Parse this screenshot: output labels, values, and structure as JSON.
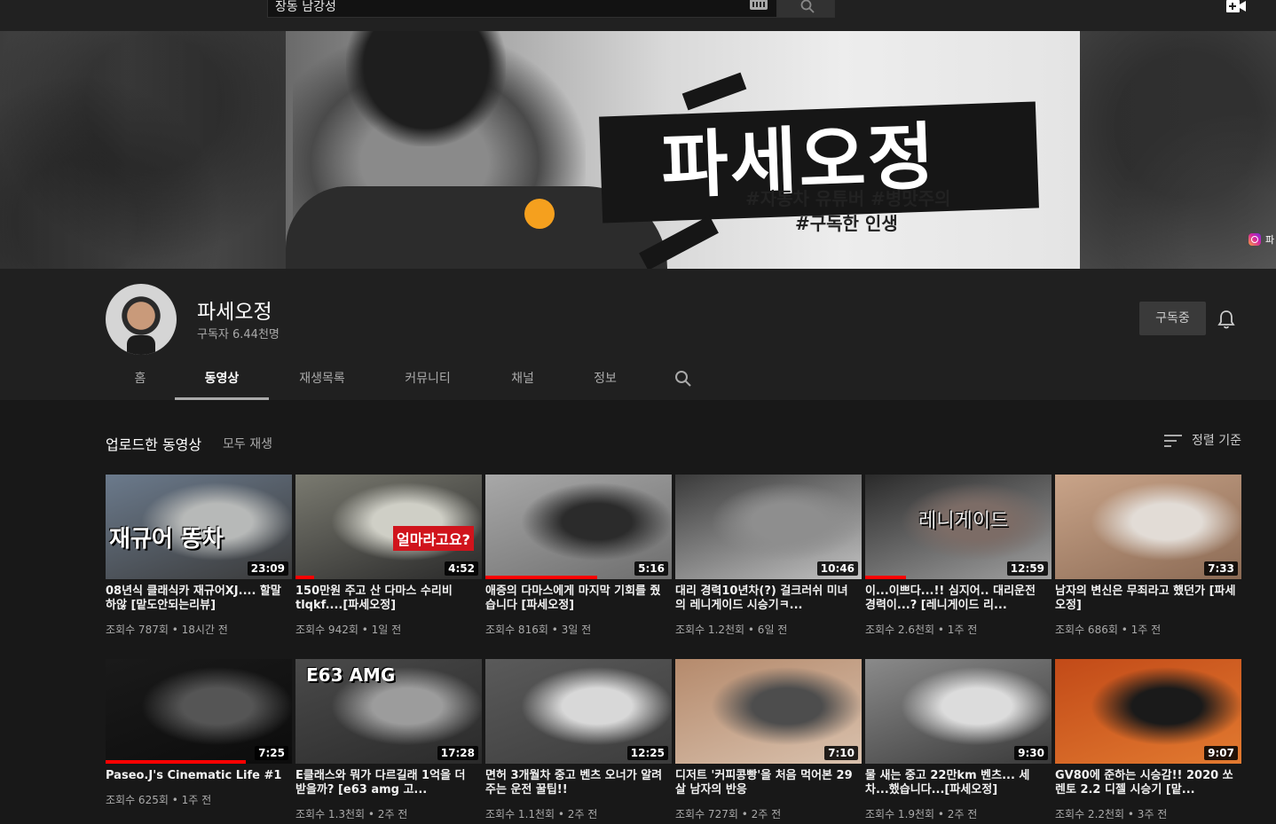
{
  "search": {
    "query": "장동 남강성"
  },
  "banner": {
    "title": "파세오정",
    "tag_line1": "#자동차 유튜버 #병맛주의",
    "tag_line2": "#구독한 인생",
    "link_text": "파",
    "accent_color": "#f5a01e"
  },
  "channel": {
    "name": "파세오정",
    "subscribers": "구독자 6.44천명",
    "subscribe_label": "구독중"
  },
  "tabs": [
    "홈",
    "동영상",
    "재생목록",
    "커뮤니티",
    "채널",
    "정보"
  ],
  "active_tab": "동영상",
  "section": {
    "title": "업로드한 동영상",
    "play_all": "모두 재생",
    "sort_label": "정렬 기준"
  },
  "videos": [
    {
      "title": "08년식 클래식카 재규어XJ.... 할말하않 [맡도안되는리뷰]",
      "meta": "조회수 787회 • 18시간 전",
      "duration": "23:09",
      "overlay": "재규어 똥차",
      "thumb_colors": [
        "#6b7a8c",
        "#b7b9b8",
        "#3a3a3a"
      ],
      "progress": 0
    },
    {
      "title": "150만원 주고 산 다마스 수리비 tlqkf....[파세오정]",
      "meta": "조회수 942회 • 1일 전",
      "duration": "4:52",
      "overlay": "얼마라고요?",
      "thumb_colors": [
        "#7a7a70",
        "#cfcfc6",
        "#2a2a2a"
      ],
      "progress": 0.1
    },
    {
      "title": "애증의 다마스에게 마지막 기회를 줬습니다 [파세오정]",
      "meta": "조회수 816회 • 3일 전",
      "duration": "5:16",
      "overlay": "",
      "thumb_colors": [
        "#a8a8a8",
        "#2b2b2b",
        "#6e6e6e"
      ],
      "progress": 0.6
    },
    {
      "title": "대리 경력10년차(?) 걸크러쉬 미녀의 레니게이드 시승기ㅋ...",
      "meta": "조회수 1.2천회 • 6일 전",
      "duration": "10:46",
      "overlay": "",
      "thumb_colors": [
        "#3a3a3a",
        "#8e8e8e",
        "#c2c2c2"
      ],
      "progress": 0
    },
    {
      "title": "이...이쁘다...!! 심지어.. 대리운전 경력이...? [레니게이드 리...",
      "meta": "조회수 2.6천회 • 1주 전",
      "duration": "12:59",
      "overlay": "레니게이드",
      "thumb_colors": [
        "#2a2a2a",
        "#7c6c66",
        "#a0a0a0"
      ],
      "progress": 0.22
    },
    {
      "title": "남자의 변신은 무죄라고 했던가 [파세오정]",
      "meta": "조회수 686회 • 1주 전",
      "duration": "7:33",
      "overlay": "",
      "thumb_colors": [
        "#c9a489",
        "#e2dcd6",
        "#8b6a54"
      ],
      "progress": 0
    },
    {
      "title": "Paseo.J's Cinematic Life #1",
      "meta": "조회수 625회 • 1주 전",
      "duration": "7:25",
      "overlay": "",
      "thumb_colors": [
        "#1a1a1a",
        "#555555",
        "#0c0c0c"
      ],
      "progress": 0.75
    },
    {
      "title": "E클래스와 뭐가 다르길래 1억을 더 받을까? [e63 amg 고...",
      "meta": "조회수 1.3천회 • 2주 전",
      "duration": "17:28",
      "overlay": "E63 AMG",
      "thumb_colors": [
        "#4a4a4a",
        "#9c9c9c",
        "#2a2a2a"
      ],
      "progress": 0
    },
    {
      "title": "면허 3개월차 중고 벤츠 오너가 알려주는 운전 꿀팁!!",
      "meta": "조회수 1.1천회 • 2주 전",
      "duration": "12:25",
      "overlay": "",
      "thumb_colors": [
        "#5a5a5a",
        "#d8d8d8",
        "#3c3c3c"
      ],
      "progress": 0
    },
    {
      "title": "디저트 '커피콩빵'을 처음 먹어본 29살 남자의 반응",
      "meta": "조회수 727회 • 2주 전",
      "duration": "7:10",
      "overlay": "",
      "thumb_colors": [
        "#b58a6c",
        "#4d4d4d",
        "#d9c1ad"
      ],
      "progress": 0
    },
    {
      "title": "물 새는 중고 22만km 벤츠... 세차...했습니다...[파세오정]",
      "meta": "조회수 1.9천회 • 2주 전",
      "duration": "9:30",
      "overlay": "",
      "thumb_colors": [
        "#8a8a8a",
        "#dcdcdc",
        "#3a3a3a"
      ],
      "progress": 0
    },
    {
      "title": "GV80에 준하는 시승감!! 2020 쏘렌토 2.2 디젤 시승기 [맡...",
      "meta": "조회수 2.2천회 • 3주 전",
      "duration": "9:07",
      "overlay": "",
      "thumb_colors": [
        "#c24a18",
        "#1a1a1a",
        "#e27a30"
      ],
      "progress": 0
    }
  ]
}
